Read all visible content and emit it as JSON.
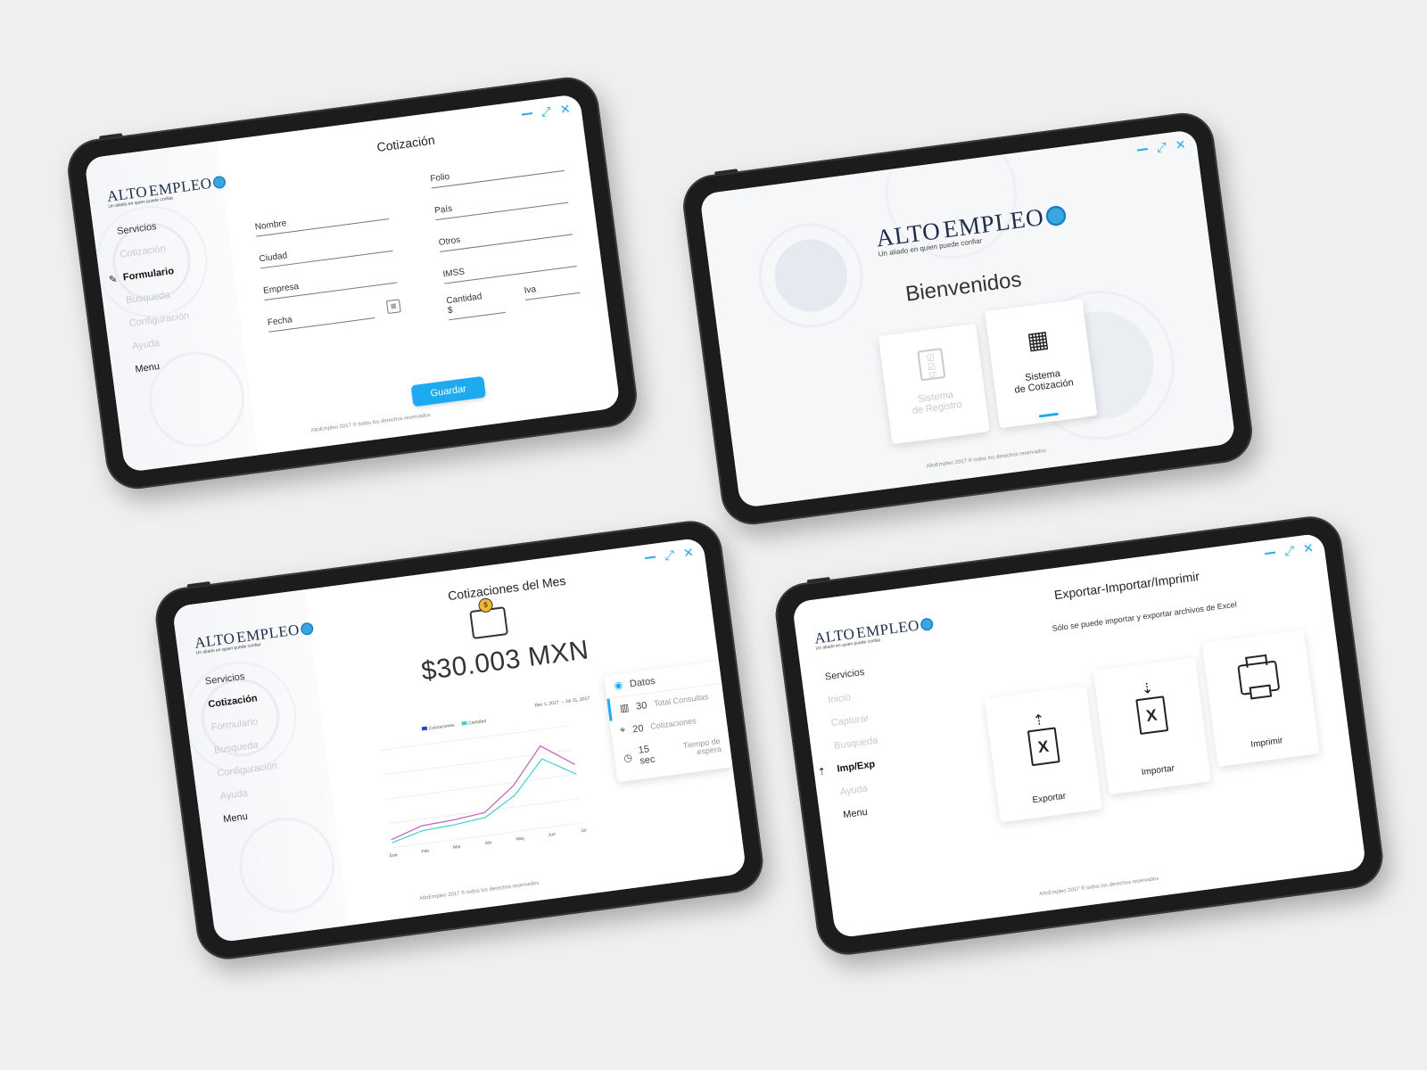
{
  "brand": {
    "name_part1": "ALTO",
    "name_part2": "EMPLEO",
    "tagline": "Un aliado en quien puede confiar"
  },
  "footer": "AltoEmpleo 2017 ® todos los derechos reservados",
  "window_controls": {
    "min": "—",
    "max": "⤢",
    "close": "✕"
  },
  "colors": {
    "accent": "#1eaaf1",
    "line_pink": "#c060c0",
    "line_cyan": "#3fd0c8",
    "line_blue": "#2a48c8"
  },
  "form_screen": {
    "title": "Cotización",
    "sidebar": {
      "header": "Servicios",
      "items": [
        "Cotización",
        "Formulario",
        "Busqueda",
        "Configuración",
        "Ayuda"
      ],
      "active": "Formulario",
      "menu": "Menu"
    },
    "fields_left": [
      "Nombre",
      "Ciudad",
      "Empresa",
      "Fecha"
    ],
    "fields_right": [
      "Folio",
      "País",
      "Otros",
      "IMSS"
    ],
    "cantidad_label": "Cantidad",
    "cantidad_sign": "$",
    "iva_label": "Iva",
    "save_button": "Guardar"
  },
  "welcome_screen": {
    "title": "Bienvenidos",
    "cards": [
      {
        "label_line1": "Sistema",
        "label_line2": "de Registro",
        "icon": "checklist-icon",
        "enabled": false
      },
      {
        "label_line1": "Sistema",
        "label_line2": "de Cotización",
        "icon": "calculator-document-icon",
        "enabled": true
      }
    ]
  },
  "dashboard_screen": {
    "title": "Cotizaciones del Mes",
    "amount": "$30.003 MXN",
    "sidebar": {
      "header": "Servicios",
      "items": [
        "Cotización",
        "Formulario",
        "Busqueda",
        "Configuración",
        "Ayuda"
      ],
      "active": "Cotización",
      "menu": "Menu"
    },
    "datos": {
      "header": "Datos",
      "rows": [
        {
          "value": "30",
          "label": "Total Consultas",
          "icon": "bar-chart-icon"
        },
        {
          "value": "20",
          "label": "Cotizaciones",
          "icon": "location-pin-icon"
        },
        {
          "value": "15 sec",
          "label": "Tiempo de espera",
          "icon": "clock-icon"
        }
      ]
    },
    "chart": {
      "legend": [
        "Cotizaciones",
        "Cantidad"
      ],
      "range_label": "Dec 1, 2017 → Jul 31, 2017"
    }
  },
  "chart_data": {
    "type": "line",
    "categories": [
      "Ene",
      "Feb",
      "Mar",
      "Abr",
      "May",
      "Jun",
      "Jul"
    ],
    "series": [
      {
        "name": "Cotizaciones",
        "values": [
          0.5,
          1.1,
          1.2,
          1.4,
          2.8,
          5.0,
          3.6
        ]
      },
      {
        "name": "Cantidad",
        "values": [
          0.3,
          0.8,
          0.9,
          1.1,
          2.2,
          4.2,
          3.0
        ]
      }
    ],
    "ylim": [
      0,
      6
    ]
  },
  "export_screen": {
    "title": "Exportar-Importar/Imprimir",
    "subtitle": "Sólo se puede importar y exportar archivos de Excel",
    "sidebar": {
      "header": "Servicios",
      "items": [
        "Inicio",
        "Capturar",
        "Busqueda",
        "Imp/Exp",
        "Ayuda"
      ],
      "active": "Imp/Exp",
      "menu": "Menu"
    },
    "cards": [
      {
        "label": "Exportar",
        "icon": "excel-upload-icon"
      },
      {
        "label": "Importar",
        "icon": "excel-download-icon"
      },
      {
        "label": "Imprimir",
        "icon": "printer-icon"
      }
    ]
  }
}
